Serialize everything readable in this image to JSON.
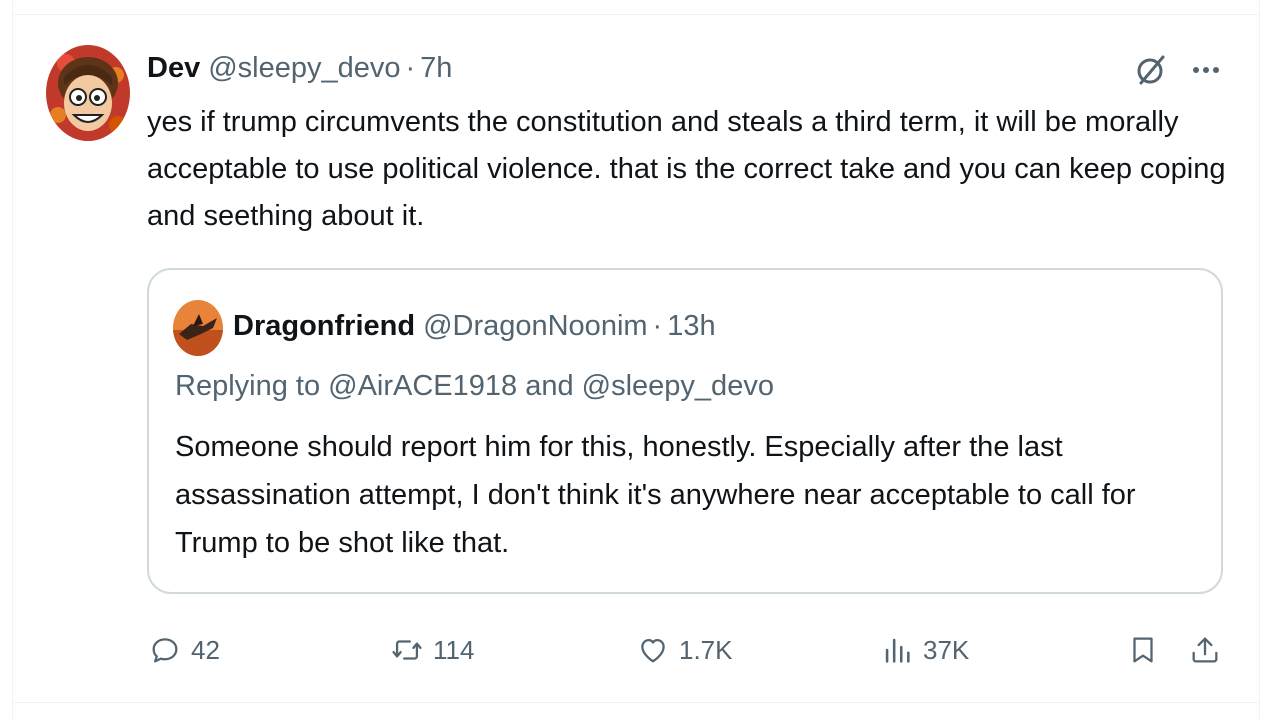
{
  "post": {
    "display_name": "Dev",
    "handle": "@sleepy_devo",
    "separator": "·",
    "time": "7h",
    "text": "yes if trump circumvents the constitution and steals a third term, it will be morally acceptable to use political violence. that is the correct take and you can keep coping and seething about it."
  },
  "quote": {
    "display_name": "Dragonfriend",
    "handle": "@DragonNoonim",
    "separator": "·",
    "time": "13h",
    "replying_to": "Replying to @AirACE1918 and @sleepy_devo",
    "text": "Someone should report him for this, honestly. Especially after the last assassination attempt, I don't think it's anywhere near acceptable to call for Trump to be shot like that."
  },
  "actions": {
    "replies": "42",
    "reposts": "114",
    "likes": "1.7K",
    "views": "37K"
  },
  "icons": {
    "grok": "grok-icon",
    "more": "more-icon",
    "reply": "reply-icon",
    "repost": "repost-icon",
    "like": "heart-icon",
    "views": "views-icon",
    "bookmark": "bookmark-icon",
    "share": "share-icon"
  },
  "colors": {
    "text_primary": "#0f1419",
    "text_secondary": "#536471",
    "border": "#cfd9de",
    "divider": "#eff3f4"
  }
}
